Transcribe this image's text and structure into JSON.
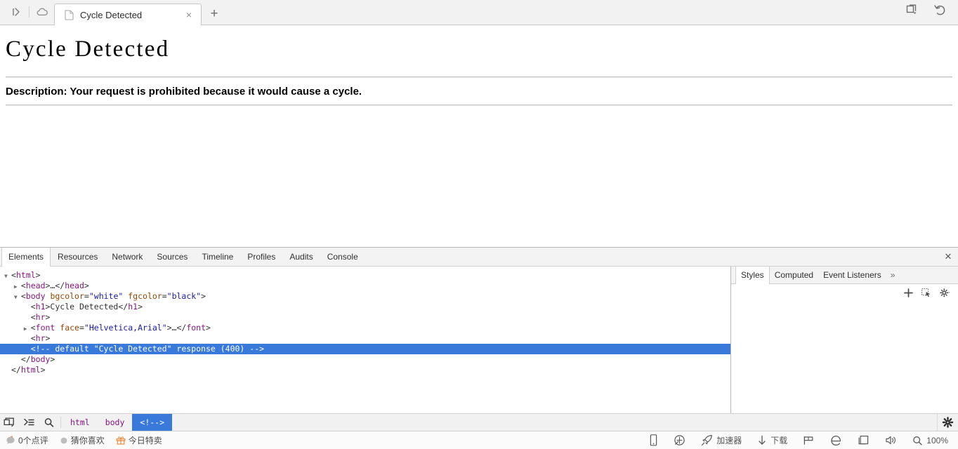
{
  "browser": {
    "left_icons": [
      {
        "name": "show-tabs-icon",
        "glyph": "tabs-triangle"
      },
      {
        "name": "cloud-icon",
        "glyph": "cloud"
      }
    ],
    "tab": {
      "favicon": "page-icon",
      "title": "Cycle Detected",
      "close_label": "×"
    },
    "new_tab_label": "+",
    "right_icons": [
      {
        "name": "tab-stack-dropdown-icon",
        "glyph": "windows-chevron"
      },
      {
        "name": "undo-reopen-tab-icon",
        "glyph": "undo-arrow"
      }
    ]
  },
  "page": {
    "heading": "Cycle Detected",
    "description": "Description: Your request is prohibited because it would cause a cycle."
  },
  "devtools": {
    "tabs": [
      {
        "label": "Elements",
        "active": true
      },
      {
        "label": "Resources",
        "active": false
      },
      {
        "label": "Network",
        "active": false
      },
      {
        "label": "Sources",
        "active": false
      },
      {
        "label": "Timeline",
        "active": false
      },
      {
        "label": "Profiles",
        "active": false
      },
      {
        "label": "Audits",
        "active": false
      },
      {
        "label": "Console",
        "active": false
      }
    ],
    "close_label": "✕",
    "dom_lines": [
      {
        "indent": 0,
        "triangle": "open",
        "selected": false,
        "parts": [
          {
            "t": "pn",
            "v": "<"
          },
          {
            "t": "tg",
            "v": "html"
          },
          {
            "t": "pn",
            "v": ">"
          }
        ]
      },
      {
        "indent": 1,
        "triangle": "closed",
        "selected": false,
        "parts": [
          {
            "t": "pn",
            "v": "<"
          },
          {
            "t": "tg",
            "v": "head"
          },
          {
            "t": "pn",
            "v": ">…</"
          },
          {
            "t": "tg",
            "v": "head"
          },
          {
            "t": "pn",
            "v": ">"
          }
        ]
      },
      {
        "indent": 1,
        "triangle": "open",
        "selected": false,
        "parts": [
          {
            "t": "pn",
            "v": "<"
          },
          {
            "t": "tg",
            "v": "body"
          },
          {
            "t": "pn",
            "v": " "
          },
          {
            "t": "an",
            "v": "bgcolor"
          },
          {
            "t": "pn",
            "v": "="
          },
          {
            "t": "av",
            "v": "\"white\""
          },
          {
            "t": "pn",
            "v": " "
          },
          {
            "t": "an",
            "v": "fgcolor"
          },
          {
            "t": "pn",
            "v": "="
          },
          {
            "t": "av",
            "v": "\"black\""
          },
          {
            "t": "pn",
            "v": ">"
          }
        ]
      },
      {
        "indent": 2,
        "triangle": "none",
        "selected": false,
        "parts": [
          {
            "t": "pn",
            "v": "<"
          },
          {
            "t": "tg",
            "v": "h1"
          },
          {
            "t": "pn",
            "v": ">Cycle Detected</"
          },
          {
            "t": "tg",
            "v": "h1"
          },
          {
            "t": "pn",
            "v": ">"
          }
        ]
      },
      {
        "indent": 2,
        "triangle": "none",
        "selected": false,
        "parts": [
          {
            "t": "pn",
            "v": "<"
          },
          {
            "t": "tg",
            "v": "hr"
          },
          {
            "t": "pn",
            "v": ">"
          }
        ]
      },
      {
        "indent": 2,
        "triangle": "closed",
        "selected": false,
        "parts": [
          {
            "t": "pn",
            "v": "<"
          },
          {
            "t": "tg",
            "v": "font"
          },
          {
            "t": "pn",
            "v": " "
          },
          {
            "t": "an",
            "v": "face"
          },
          {
            "t": "pn",
            "v": "="
          },
          {
            "t": "av",
            "v": "\"Helvetica,Arial\""
          },
          {
            "t": "pn",
            "v": ">…</"
          },
          {
            "t": "tg",
            "v": "font"
          },
          {
            "t": "pn",
            "v": ">"
          }
        ]
      },
      {
        "indent": 2,
        "triangle": "none",
        "selected": false,
        "parts": [
          {
            "t": "pn",
            "v": "<"
          },
          {
            "t": "tg",
            "v": "hr"
          },
          {
            "t": "pn",
            "v": ">"
          }
        ]
      },
      {
        "indent": 2,
        "triangle": "none",
        "selected": true,
        "parts": [
          {
            "t": "cm",
            "v": "<!-- default \"Cycle Detected\" response (400) -->"
          }
        ]
      },
      {
        "indent": 1,
        "triangle": "none",
        "selected": false,
        "parts": [
          {
            "t": "pn",
            "v": "</"
          },
          {
            "t": "tg",
            "v": "body"
          },
          {
            "t": "pn",
            "v": ">"
          }
        ]
      },
      {
        "indent": 0,
        "triangle": "none",
        "selected": false,
        "parts": [
          {
            "t": "pn",
            "v": "</"
          },
          {
            "t": "tg",
            "v": "html"
          },
          {
            "t": "pn",
            "v": ">"
          }
        ]
      }
    ],
    "styles_tabs": [
      {
        "label": "Styles",
        "active": true
      },
      {
        "label": "Computed",
        "active": false
      },
      {
        "label": "Event Listeners",
        "active": false
      }
    ],
    "styles_more_label": "»",
    "styles_toolbar": [
      {
        "name": "add-style-rule-icon",
        "glyph": "plus"
      },
      {
        "name": "element-state-icon",
        "glyph": "state"
      },
      {
        "name": "styles-settings-gear-icon",
        "glyph": "gear-caret"
      }
    ],
    "bottom_icons": [
      {
        "name": "dock-position-icon",
        "glyph": "dock"
      },
      {
        "name": "console-drawer-icon",
        "glyph": "console"
      },
      {
        "name": "search-icon",
        "glyph": "magnifier"
      }
    ],
    "breadcrumbs": [
      {
        "label": "html",
        "active": false
      },
      {
        "label": "body",
        "active": false
      },
      {
        "label": "<!-->",
        "active": true
      }
    ],
    "settings_icon": "settings-gear-icon"
  },
  "statusbar": {
    "left_items": [
      {
        "icon": "comment-bubble-icon",
        "label": "0个点评"
      },
      {
        "icon": "heart-dot-icon",
        "label": "猜你喜欢"
      },
      {
        "icon": "gift-icon",
        "label": "今日特卖"
      }
    ],
    "right_items": [
      {
        "icon": "mobile-phone-icon",
        "label": ""
      },
      {
        "icon": "compass-icon",
        "label": ""
      },
      {
        "icon": "rocket-icon",
        "label": "加速器"
      },
      {
        "icon": "download-arrow-icon",
        "label": "下载"
      },
      {
        "icon": "flag-icon",
        "label": ""
      },
      {
        "icon": "edge-e-icon",
        "label": ""
      },
      {
        "icon": "window-icon",
        "label": ""
      },
      {
        "icon": "speaker-icon",
        "label": ""
      },
      {
        "icon": "zoom-magnifier-icon",
        "label": "100%"
      }
    ]
  },
  "colors": {
    "selection_blue": "#3879d9",
    "tag_purple": "#881280",
    "attr_orange": "#994500",
    "value_blue": "#1a1aa6",
    "chrome_bg": "#f2f2f2",
    "gift_orange": "#f08a3c"
  }
}
